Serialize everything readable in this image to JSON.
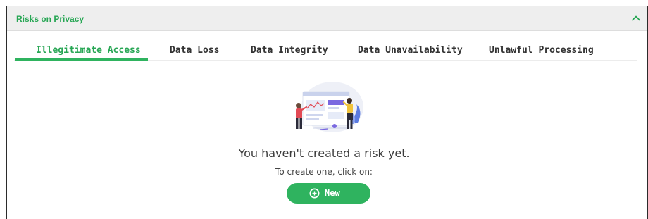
{
  "panel": {
    "title": "Risks on Privacy",
    "collapse_icon": "chevron-up-icon"
  },
  "tabs": [
    {
      "label": "Illegitimate Access",
      "active": true
    },
    {
      "label": "Data Loss",
      "active": false
    },
    {
      "label": "Data Integrity",
      "active": false
    },
    {
      "label": "Data Unavailability",
      "active": false
    },
    {
      "label": "Unlawful Processing",
      "active": false
    }
  ],
  "empty_state": {
    "illustration": "presentation-illustration",
    "title": "You haven't created a risk yet.",
    "subtitle": "To create one, click on:",
    "button_label": "New",
    "button_icon": "plus-circle-icon"
  },
  "colors": {
    "accent": "#2fb35f",
    "title_green": "#27a654",
    "header_bg": "#eeeeee"
  }
}
